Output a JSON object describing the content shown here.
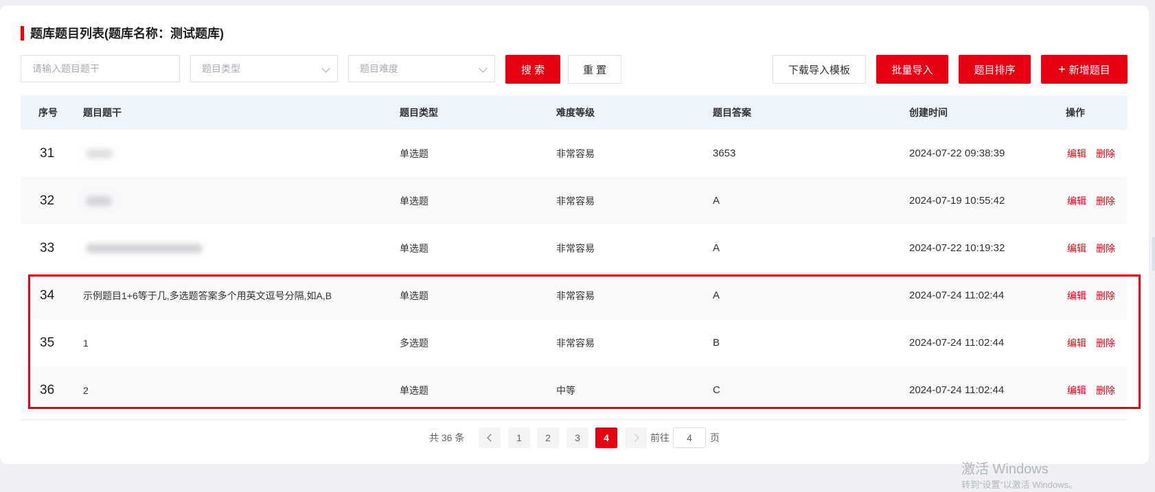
{
  "title": "题库题目列表(题库名称：测试题库)",
  "filters": {
    "stem_placeholder": "请输入题目题干",
    "type_placeholder": "题目类型",
    "difficulty_placeholder": "题目难度"
  },
  "buttons": {
    "search": "搜 索",
    "reset": "重 置",
    "download_template": "下载导入模板",
    "batch_import": "批量导入",
    "sort": "题目排序",
    "add": "新增题目"
  },
  "table": {
    "columns": [
      "序号",
      "题目题干",
      "题目类型",
      "难度等级",
      "题目答案",
      "创建时间",
      "操作"
    ],
    "rows": [
      {
        "index": "31",
        "stem": "",
        "type": "单选题",
        "difficulty": "非常容易",
        "answer": "3653",
        "created": "2024-07-22 09:38:39"
      },
      {
        "index": "32",
        "stem": "",
        "type": "单选题",
        "difficulty": "非常容易",
        "answer": "A",
        "created": "2024-07-19 10:55:42"
      },
      {
        "index": "33",
        "stem": "",
        "type": "单选题",
        "difficulty": "非常容易",
        "answer": "A",
        "created": "2024-07-22 10:19:32"
      },
      {
        "index": "34",
        "stem": "示例题目1+6等于几,多选题答案多个用英文逗号分隔,如A,B",
        "type": "单选题",
        "difficulty": "非常容易",
        "answer": "A",
        "created": "2024-07-24 11:02:44"
      },
      {
        "index": "35",
        "stem": "1",
        "type": "多选题",
        "difficulty": "非常容易",
        "answer": "B",
        "created": "2024-07-24 11:02:44"
      },
      {
        "index": "36",
        "stem": "2",
        "type": "单选题",
        "difficulty": "中等",
        "answer": "C",
        "created": "2024-07-24 11:02:44"
      }
    ],
    "actions": {
      "edit": "编辑",
      "delete": "删除"
    }
  },
  "pagination": {
    "total_text": "共 36 条",
    "pages": [
      "1",
      "2",
      "3",
      "4"
    ],
    "current": "4",
    "goto_prefix": "前往",
    "goto_value": "4",
    "goto_suffix": "页"
  },
  "watermark": {
    "line1": "激活 Windows",
    "line2": "转到“设置”以激活 Windows。"
  },
  "colors": {
    "brand": "#e60012",
    "header_bg": "#eef5fd",
    "stripe_bg": "#f8f9fb",
    "page_bg": "#eef0f4"
  }
}
